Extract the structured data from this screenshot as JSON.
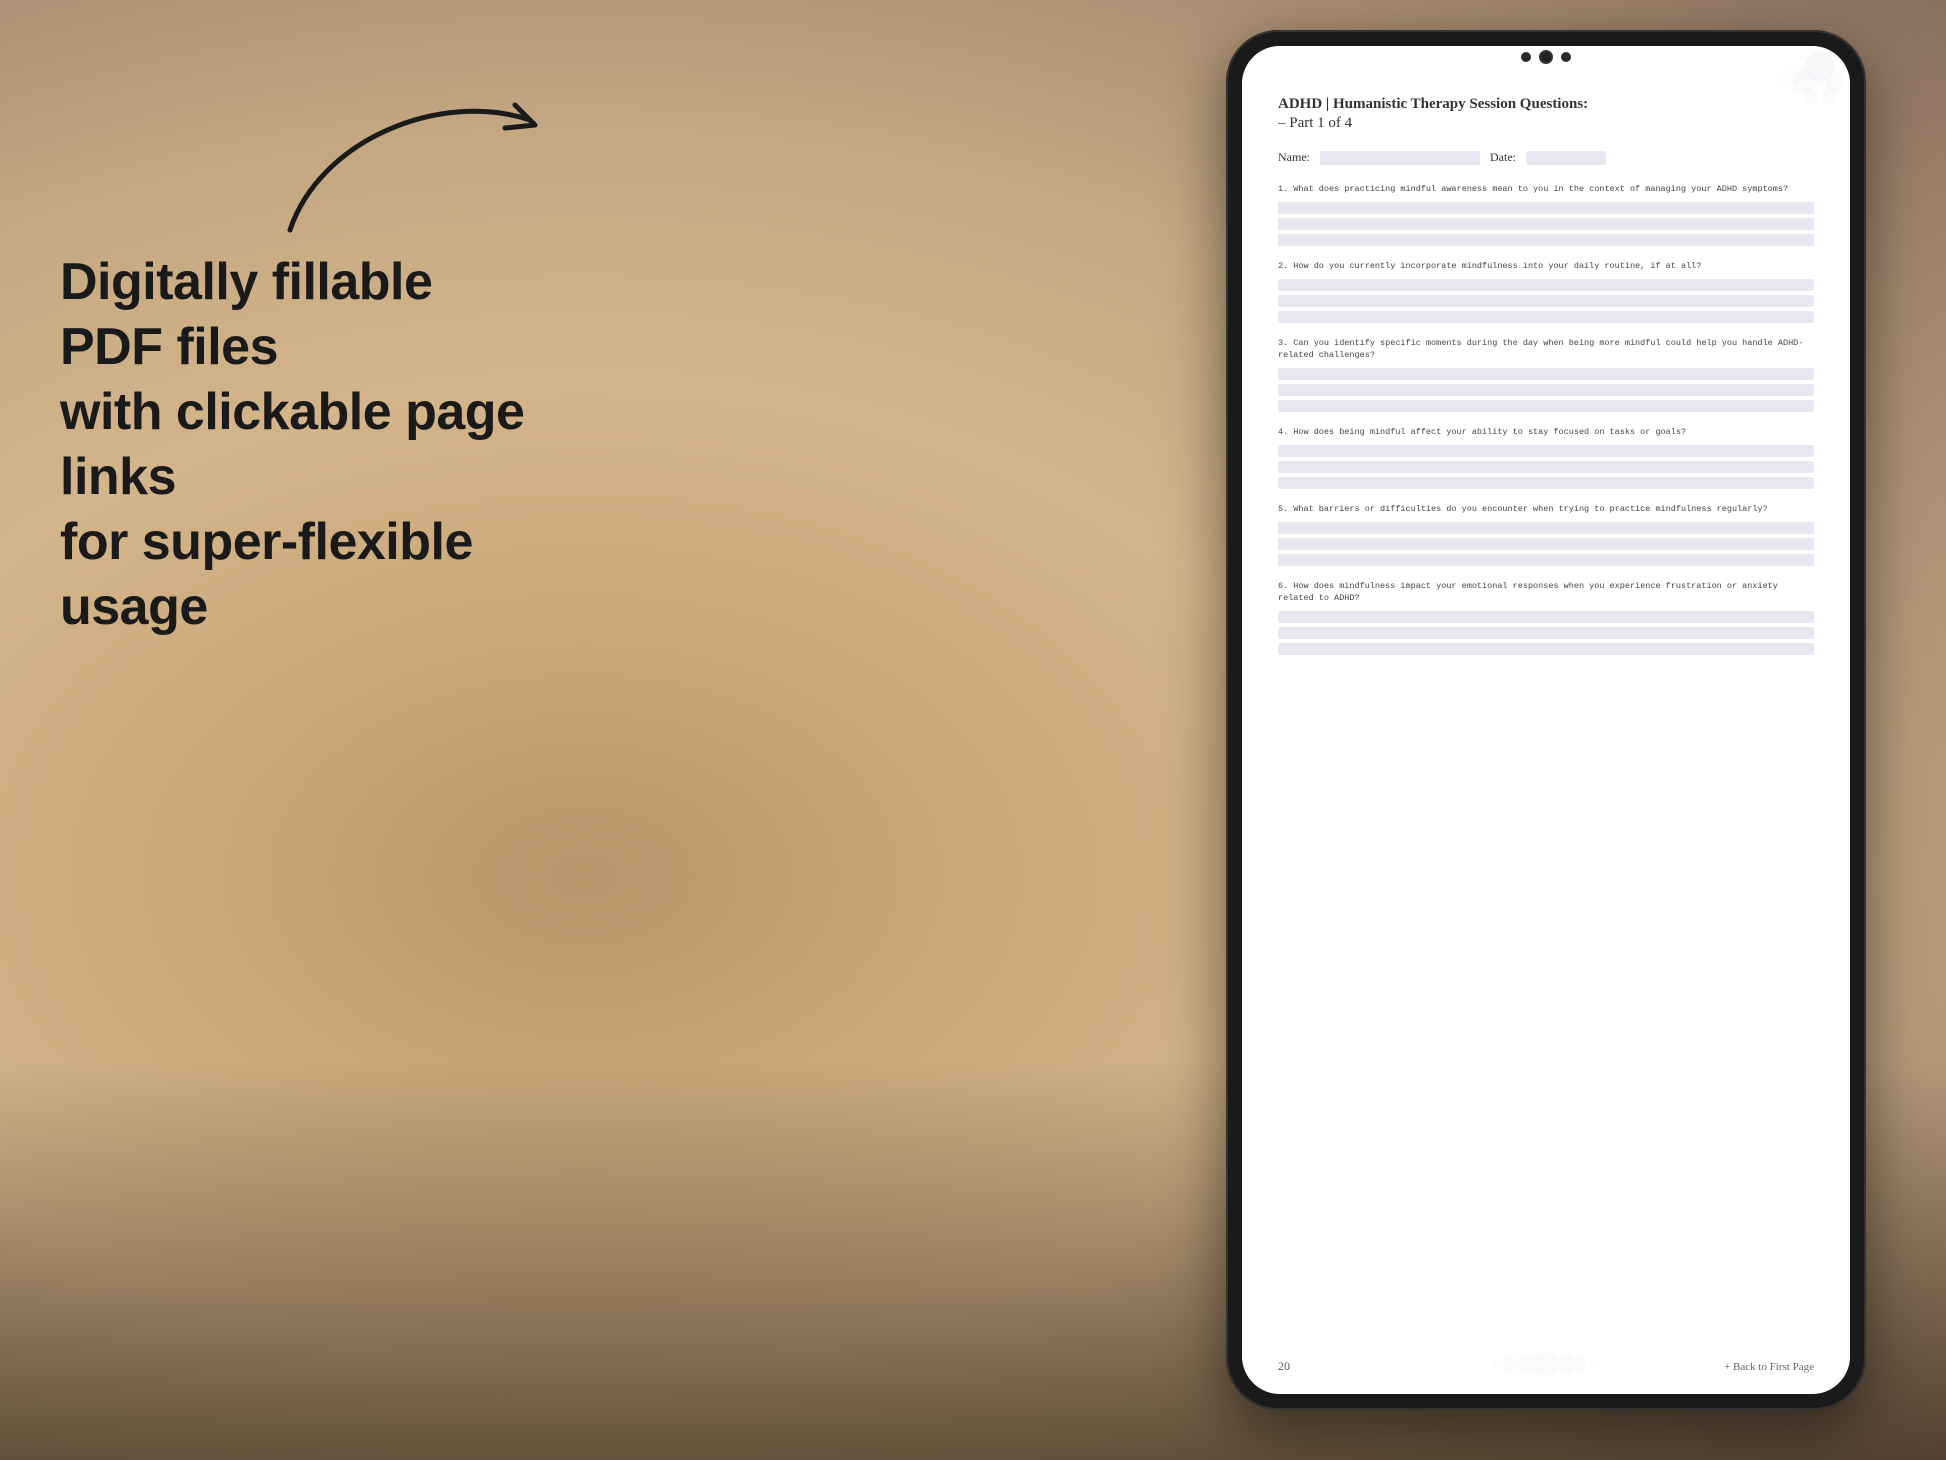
{
  "background": {
    "color": "#c4a882"
  },
  "left_text": {
    "line1": "Digitally fillable PDF files",
    "line2": "with clickable page links",
    "line3": "for super-flexible usage"
  },
  "arrow": {
    "description": "curved arrow pointing right toward tablet"
  },
  "tablet": {
    "pdf": {
      "title": "ADHD | Humanistic Therapy Session Questions:",
      "subtitle": "– Part 1 of 4",
      "name_label": "Name:",
      "date_label": "Date:",
      "questions": [
        {
          "number": "1.",
          "text": "What does practicing mindful awareness mean to you in the context of managing your ADHD\n   symptoms?"
        },
        {
          "number": "2.",
          "text": "How do you currently incorporate mindfulness into your daily routine, if at all?"
        },
        {
          "number": "3.",
          "text": "Can you identify specific moments during the day when being more mindful could help you\n   handle ADHD-related challenges?"
        },
        {
          "number": "4.",
          "text": "How does being mindful affect your ability to stay focused on tasks or goals?"
        },
        {
          "number": "5.",
          "text": "What barriers or difficulties do you encounter when trying to practice mindfulness\n   regularly?"
        },
        {
          "number": "6.",
          "text": "How does mindfulness impact your emotional responses when you experience frustration or\n   anxiety related to ADHD?"
        }
      ],
      "page_number": "20",
      "back_link": "+ Back to First Page"
    }
  }
}
